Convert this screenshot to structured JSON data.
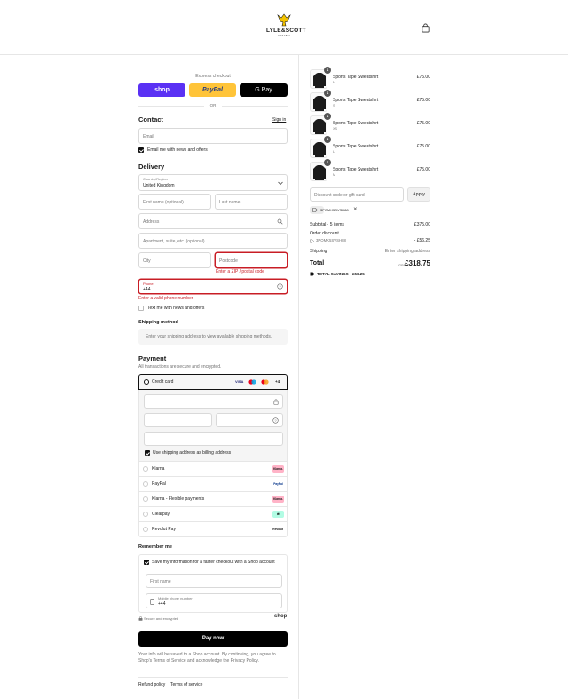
{
  "header": {
    "brand_word": "LYLE&SCOTT",
    "brand_sub": "EST 1874",
    "cart_icon": "shopping-bag-icon"
  },
  "express": {
    "title": "Express checkout",
    "shop_label": "shop",
    "paypal_label": "PayPal",
    "gpay_label": "G Pay",
    "or": "OR"
  },
  "contact": {
    "title": "Contact",
    "sign_in": "Sign in",
    "email_placeholder": "Email",
    "news_label": "Email me with news and offers"
  },
  "delivery": {
    "title": "Delivery",
    "country_label": "Country/Region",
    "country_value": "United Kingdom",
    "first_name": "First name (optional)",
    "last_name": "Last name",
    "address": "Address",
    "apartment": "Apartment, suite, etc. (optional)",
    "city": "City",
    "postcode": "Postcode",
    "postcode_error": "Enter a ZIP / postal code",
    "phone_label": "Phone",
    "phone_value": "+44",
    "phone_error": "Enter a valid phone number",
    "text_label": "Text me with news and offers"
  },
  "shipping": {
    "title": "Shipping method",
    "message": "Enter your shipping address to view available shipping methods."
  },
  "payment": {
    "title": "Payment",
    "subtitle": "All transactions are secure and encrypted.",
    "credit_card": "Credit card",
    "card_brands": [
      "VISA",
      "MC",
      "MC",
      "+4"
    ],
    "billing_label": "Use shipping address as billing address",
    "options": [
      {
        "name": "Klarna",
        "badge": "Klarna.",
        "color": "#ffb3c7",
        "text_color": "#111"
      },
      {
        "name": "PayPal",
        "badge": "PayPal",
        "color": "#ffffff",
        "text_color": "#003087"
      },
      {
        "name": "Klarna - Flexible payments",
        "badge": "Klarna.",
        "color": "#ffb3c7",
        "text_color": "#111"
      },
      {
        "name": "Clearpay",
        "badge": "⇄",
        "color": "#b2fce4",
        "text_color": "#111"
      },
      {
        "name": "Revolut Pay",
        "badge": "Revolut",
        "color": "#ffffff",
        "text_color": "#111"
      }
    ]
  },
  "remember": {
    "title": "Remember me",
    "save_label": "Save my information for a faster checkout with a Shop account",
    "first_name": "First name",
    "mobile_label": "Mobile phone number",
    "mobile_value": "+44",
    "secure": "Secure and encrypted",
    "shop": "shop"
  },
  "pay_now": "Pay now",
  "disclaimer": {
    "part1": "Your info will be saved to a Shop account. By continuing, you agree to Shop's ",
    "terms": "Terms of Service",
    "part2": " and acknowledge the ",
    "privacy": "Privacy Policy",
    "part3": "."
  },
  "footer": {
    "refund": "Refund policy",
    "terms": "Terms of service"
  },
  "summary": {
    "items": [
      {
        "name": "Sports Tape Sweatshirt",
        "size": "M",
        "price": "£75.00",
        "qty": "1"
      },
      {
        "name": "Sports Tape Sweatshirt",
        "size": "S",
        "price": "£75.00",
        "qty": "1"
      },
      {
        "name": "Sports Tape Sweatshirt",
        "size": "XS",
        "price": "£75.00",
        "qty": "1"
      },
      {
        "name": "Sports Tape Sweatshirt",
        "size": "L",
        "price": "£75.00",
        "qty": "1"
      },
      {
        "name": "Sports Tape Sweatshirt",
        "size": "M",
        "price": "£75.00",
        "qty": "1"
      }
    ],
    "discount_placeholder": "Discount code or gift card",
    "apply": "Apply",
    "code": "3POMK5SVSH88",
    "subtotal_label": "Subtotal · 5 items",
    "subtotal_value": "£375.00",
    "order_discount_label": "Order discount",
    "order_discount_code": "3POMK5SVSH88",
    "order_discount_value": "- £56.25",
    "shipping_label": "Shipping",
    "shipping_value": "Enter shipping address",
    "total_label": "Total",
    "total_currency": "GBP",
    "total_value": "£318.75",
    "savings_label": "TOTAL SAVINGS",
    "savings_value": "£56.25"
  }
}
